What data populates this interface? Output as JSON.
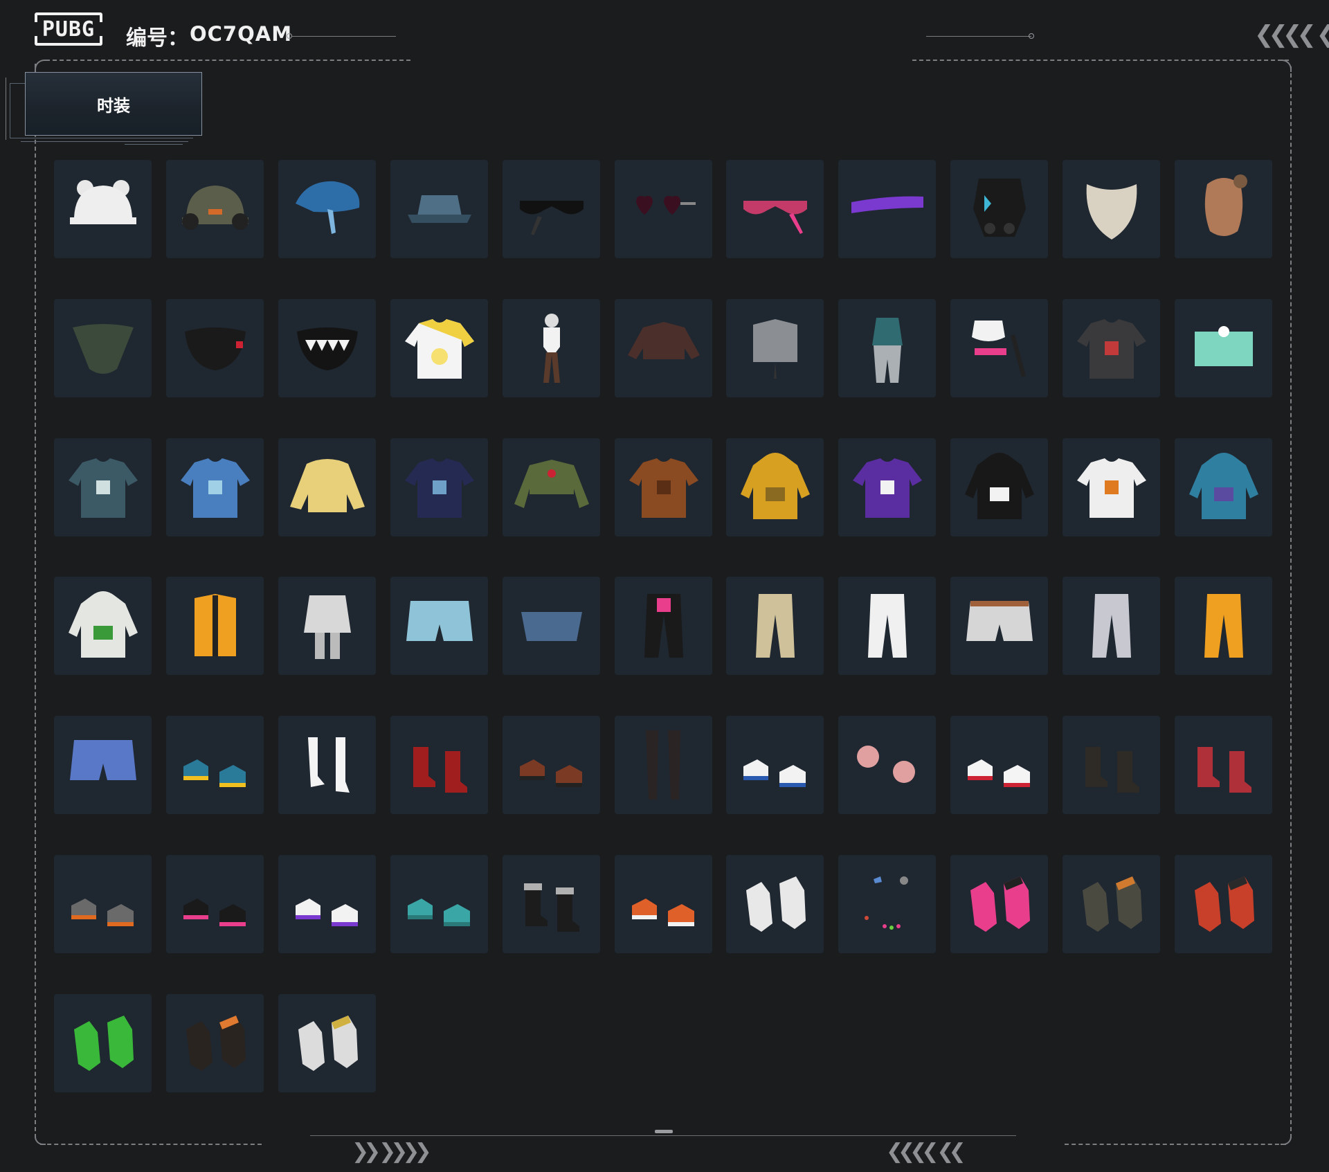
{
  "header": {
    "logo_text": "PUBG",
    "id_label": "编号：",
    "id_value": "OC7QAM"
  },
  "tabs": [
    {
      "label": "时装"
    }
  ],
  "colors": {
    "background": "#1b1c1e",
    "cell_background": "#1f2731",
    "frame_line": "#7c7e82"
  },
  "items": [
    {
      "icon": "bear-ear-beanie-icon"
    },
    {
      "icon": "headset-cap-icon"
    },
    {
      "icon": "blue-beret-icon"
    },
    {
      "icon": "bucket-hat-icon"
    },
    {
      "icon": "tactical-glasses-icon"
    },
    {
      "icon": "heart-glasses-icon"
    },
    {
      "icon": "cyber-visor-icon"
    },
    {
      "icon": "purple-visor-icon"
    },
    {
      "icon": "tactical-mask-icon"
    },
    {
      "icon": "beard-icon"
    },
    {
      "icon": "face-icon"
    },
    {
      "icon": "camo-bandana-icon"
    },
    {
      "icon": "black-face-mask-icon"
    },
    {
      "icon": "teeth-mask-icon"
    },
    {
      "icon": "chick-tshirt-icon"
    },
    {
      "icon": "bodysuit-icon"
    },
    {
      "icon": "crop-jacket-icon"
    },
    {
      "icon": "armor-vest-icon"
    },
    {
      "icon": "teal-outfit-icon"
    },
    {
      "icon": "sport-top-icon"
    },
    {
      "icon": "tactical-jacket-icon"
    },
    {
      "icon": "tube-top-icon"
    },
    {
      "icon": "floral-shirt-icon"
    },
    {
      "icon": "holo-jacket-icon"
    },
    {
      "icon": "yellow-sweater-icon"
    },
    {
      "icon": "navy-sweatshirt-icon"
    },
    {
      "icon": "bomber-crop-icon"
    },
    {
      "icon": "leather-jacket-icon"
    },
    {
      "icon": "yellow-hoodie-icon"
    },
    {
      "icon": "purple-jacket-icon"
    },
    {
      "icon": "black-hoodie-icon"
    },
    {
      "icon": "white-orange-jacket-icon"
    },
    {
      "icon": "gradient-hoodie-icon"
    },
    {
      "icon": "white-hoodie-icon"
    },
    {
      "icon": "puffer-vest-icon"
    },
    {
      "icon": "cargo-skirt-icon"
    },
    {
      "icon": "denim-shorts-icon"
    },
    {
      "icon": "denim-skirt-icon"
    },
    {
      "icon": "chaps-pants-icon"
    },
    {
      "icon": "khaki-pants-icon"
    },
    {
      "icon": "purple-pants-icon"
    },
    {
      "icon": "white-shorts-icon"
    },
    {
      "icon": "camo-pants-icon"
    },
    {
      "icon": "orange-pants-icon"
    },
    {
      "icon": "gradient-shorts-icon"
    },
    {
      "icon": "colorful-sneakers-icon"
    },
    {
      "icon": "white-heels-icon"
    },
    {
      "icon": "red-boots-icon"
    },
    {
      "icon": "sandals-icon"
    },
    {
      "icon": "stockings-icon"
    },
    {
      "icon": "blue-sneakers-icon"
    },
    {
      "icon": "pink-slippers-icon"
    },
    {
      "icon": "white-sneakers-icon"
    },
    {
      "icon": "combat-boots-icon"
    },
    {
      "icon": "red-spiked-boots-icon"
    },
    {
      "icon": "grey-sneakers-icon"
    },
    {
      "icon": "black-pink-boots-icon"
    },
    {
      "icon": "purple-sneakers-icon"
    },
    {
      "icon": "teal-clogs-icon"
    },
    {
      "icon": "fur-boots-icon"
    },
    {
      "icon": "orange-high-tops-icon"
    },
    {
      "icon": "white-gloves-icon"
    },
    {
      "icon": "nail-art-icon"
    },
    {
      "icon": "pink-gloves-icon"
    },
    {
      "icon": "camo-gloves-icon"
    },
    {
      "icon": "red-tactical-gloves-icon"
    },
    {
      "icon": "green-gloves-icon"
    },
    {
      "icon": "orange-gloves-icon"
    },
    {
      "icon": "yellow-white-gloves-icon"
    }
  ]
}
